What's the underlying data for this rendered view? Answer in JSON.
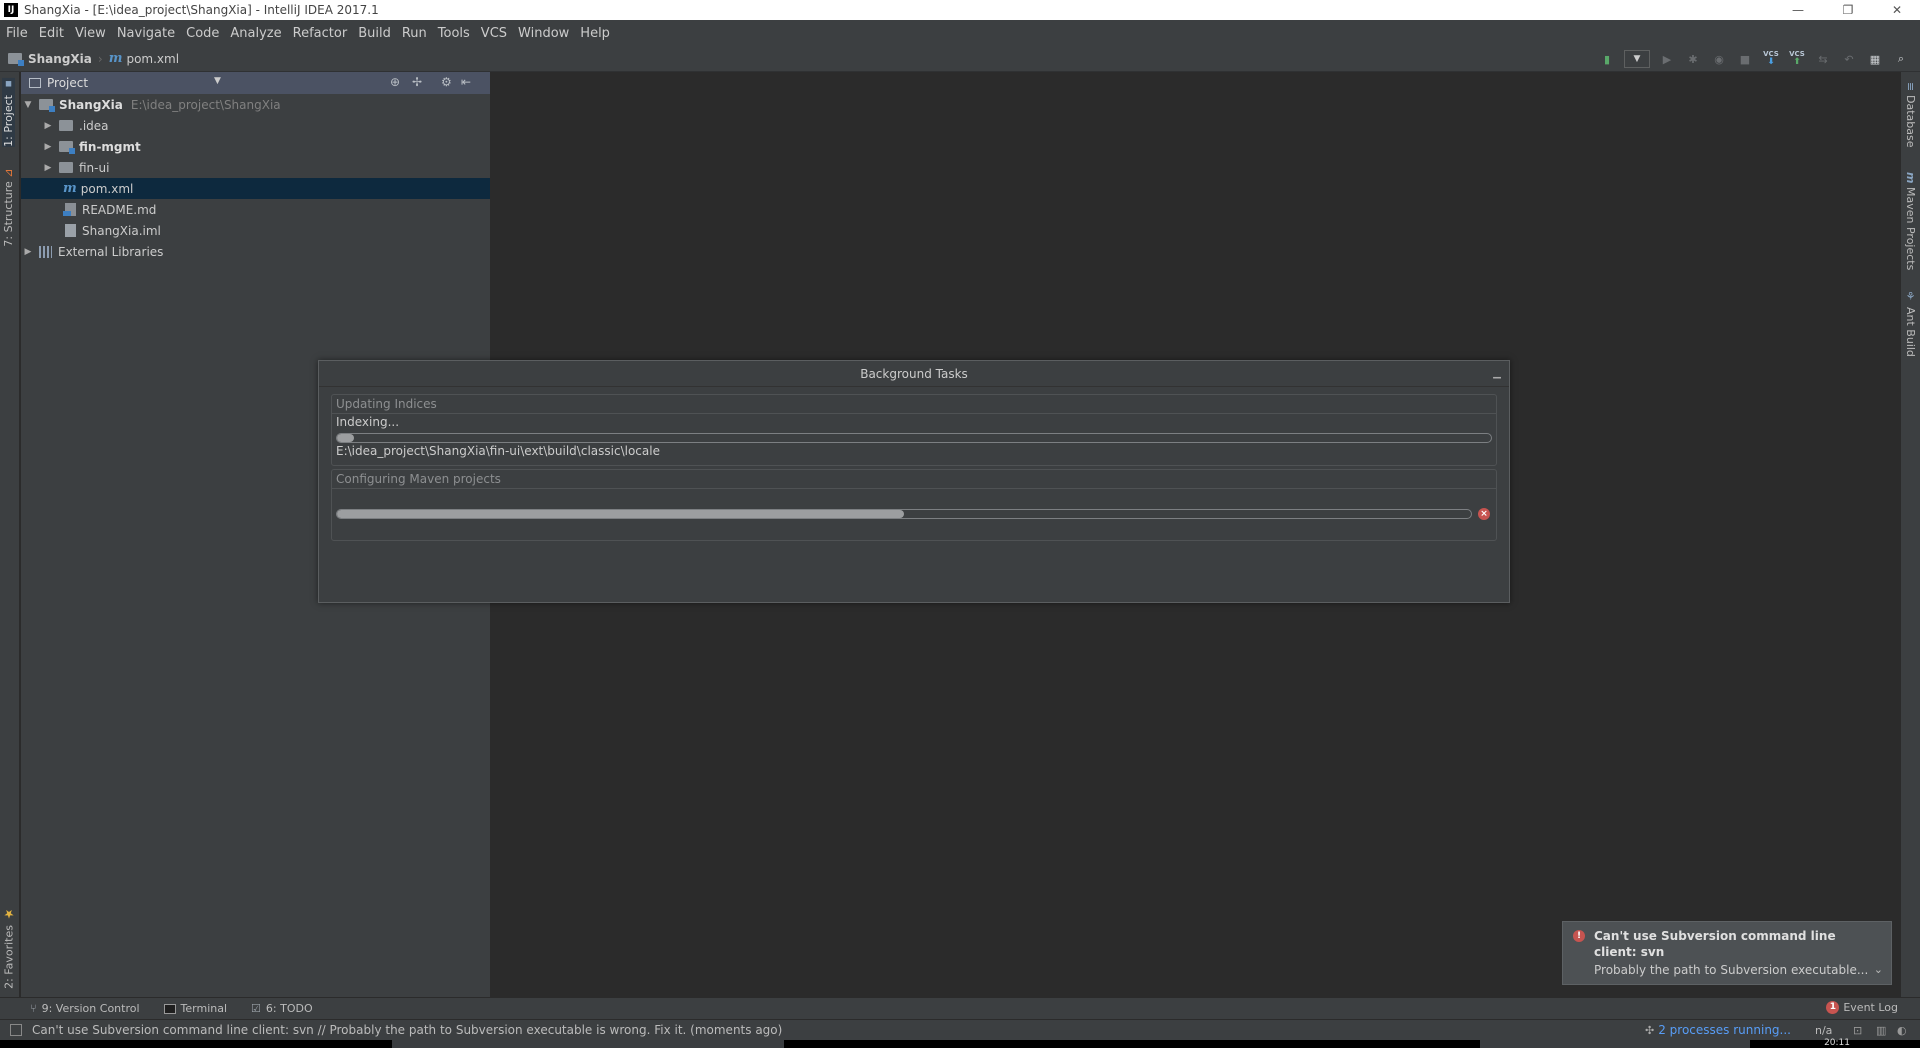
{
  "window": {
    "title": "ShangXia - [E:\\idea_project\\ShangXia] - IntelliJ IDEA 2017.1",
    "logo_text": "IJ",
    "controls": [
      "—",
      "❐",
      "✕"
    ]
  },
  "menu": [
    "File",
    "Edit",
    "View",
    "Navigate",
    "Code",
    "Analyze",
    "Refactor",
    "Build",
    "Run",
    "Tools",
    "VCS",
    "Window",
    "Help"
  ],
  "breadcrumb": {
    "project": "ShangXia",
    "file": "pom.xml"
  },
  "toolbar": {
    "vcs_label": "VCS"
  },
  "left_tabs": {
    "project": "1: Project",
    "structure": "7: Structure",
    "favorites": "2: Favorites"
  },
  "right_tabs": {
    "database": "Database",
    "maven": "Maven Projects",
    "ant": "Ant Build"
  },
  "project_panel": {
    "title": "Project",
    "tree": [
      {
        "name": "ShangXia",
        "path": "E:\\idea_project\\ShangXia",
        "type": "module"
      },
      {
        "name": ".idea",
        "type": "folder"
      },
      {
        "name": "fin-mgmt",
        "type": "module"
      },
      {
        "name": "fin-ui",
        "type": "folder"
      },
      {
        "name": "pom.xml",
        "type": "maven"
      },
      {
        "name": "README.md",
        "type": "md"
      },
      {
        "name": "ShangXia.iml",
        "type": "iml"
      },
      {
        "name": "External Libraries",
        "type": "libraries"
      }
    ]
  },
  "background_tasks": {
    "title": "Background Tasks",
    "groups": [
      {
        "title": "Updating Indices",
        "status": "Indexing...",
        "detail": "E:\\idea_project\\ShangXia\\fin-ui\\ext\\build\\classic\\locale",
        "progress": 0.015
      },
      {
        "title": "Configuring Maven projects",
        "progress": 0.5
      }
    ]
  },
  "notification": {
    "title": "Can't use Subversion command line client: svn",
    "body": "Probably the path to Subversion executable..."
  },
  "tool_windows": {
    "version_control": "9: Version Control",
    "terminal": "Terminal",
    "todo": "6: TODO",
    "event_log": "Event Log",
    "event_log_badge": "1"
  },
  "statusbar": {
    "message": "Can't use Subversion command line client: svn // Probably the path to Subversion executable is wrong. Fix it. (moments ago)",
    "processes": "2 processes running...",
    "position": "n/a"
  },
  "taskbar": {
    "clock": "20:11"
  },
  "colors": {
    "background": "#2b2b2b",
    "panel": "#3c3f41",
    "selection": "#0d293e",
    "link": "#589df6",
    "error": "#c75450"
  }
}
